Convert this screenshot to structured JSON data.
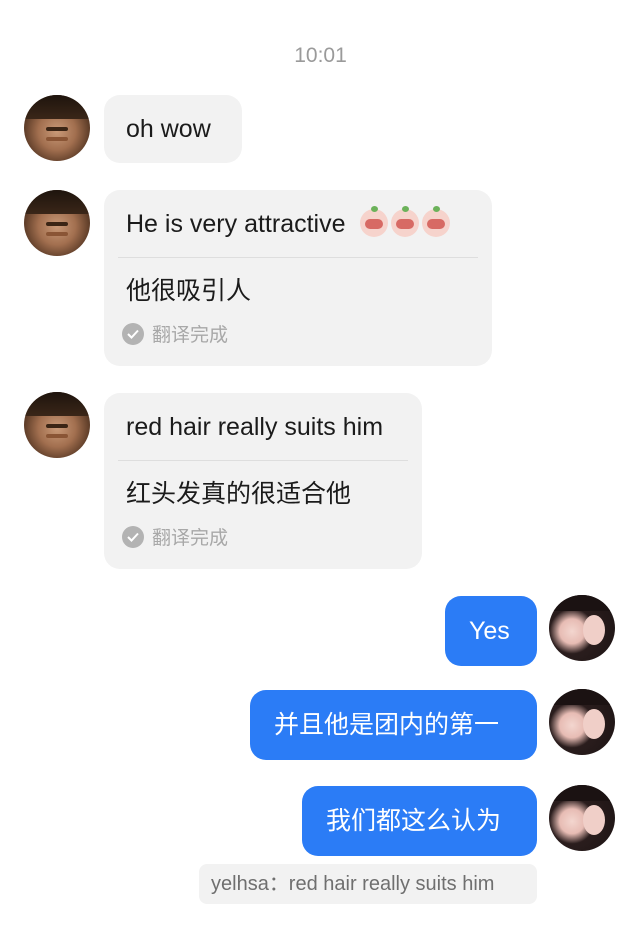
{
  "timestamp": "10:01",
  "incoming": [
    {
      "text": "oh wow"
    },
    {
      "text": "He is very attractive",
      "translation": "他很吸引人",
      "status": "翻译完成",
      "emojis": [
        "pig-emoji",
        "pig-emoji",
        "pig-emoji"
      ]
    },
    {
      "text": "red hair really suits him",
      "translation": "红头发真的很适合他",
      "status": "翻译完成"
    }
  ],
  "outgoing": [
    {
      "text": "Yes"
    },
    {
      "text": "并且他是团内的第一"
    },
    {
      "text": "我们都这么认为"
    }
  ],
  "quote": {
    "text": "yelhsa：red hair really suits him"
  },
  "colors": {
    "outgoing_bubble": "#2b7cf6",
    "incoming_bubble": "#f2f2f2",
    "timestamp": "#9a9a9a"
  }
}
